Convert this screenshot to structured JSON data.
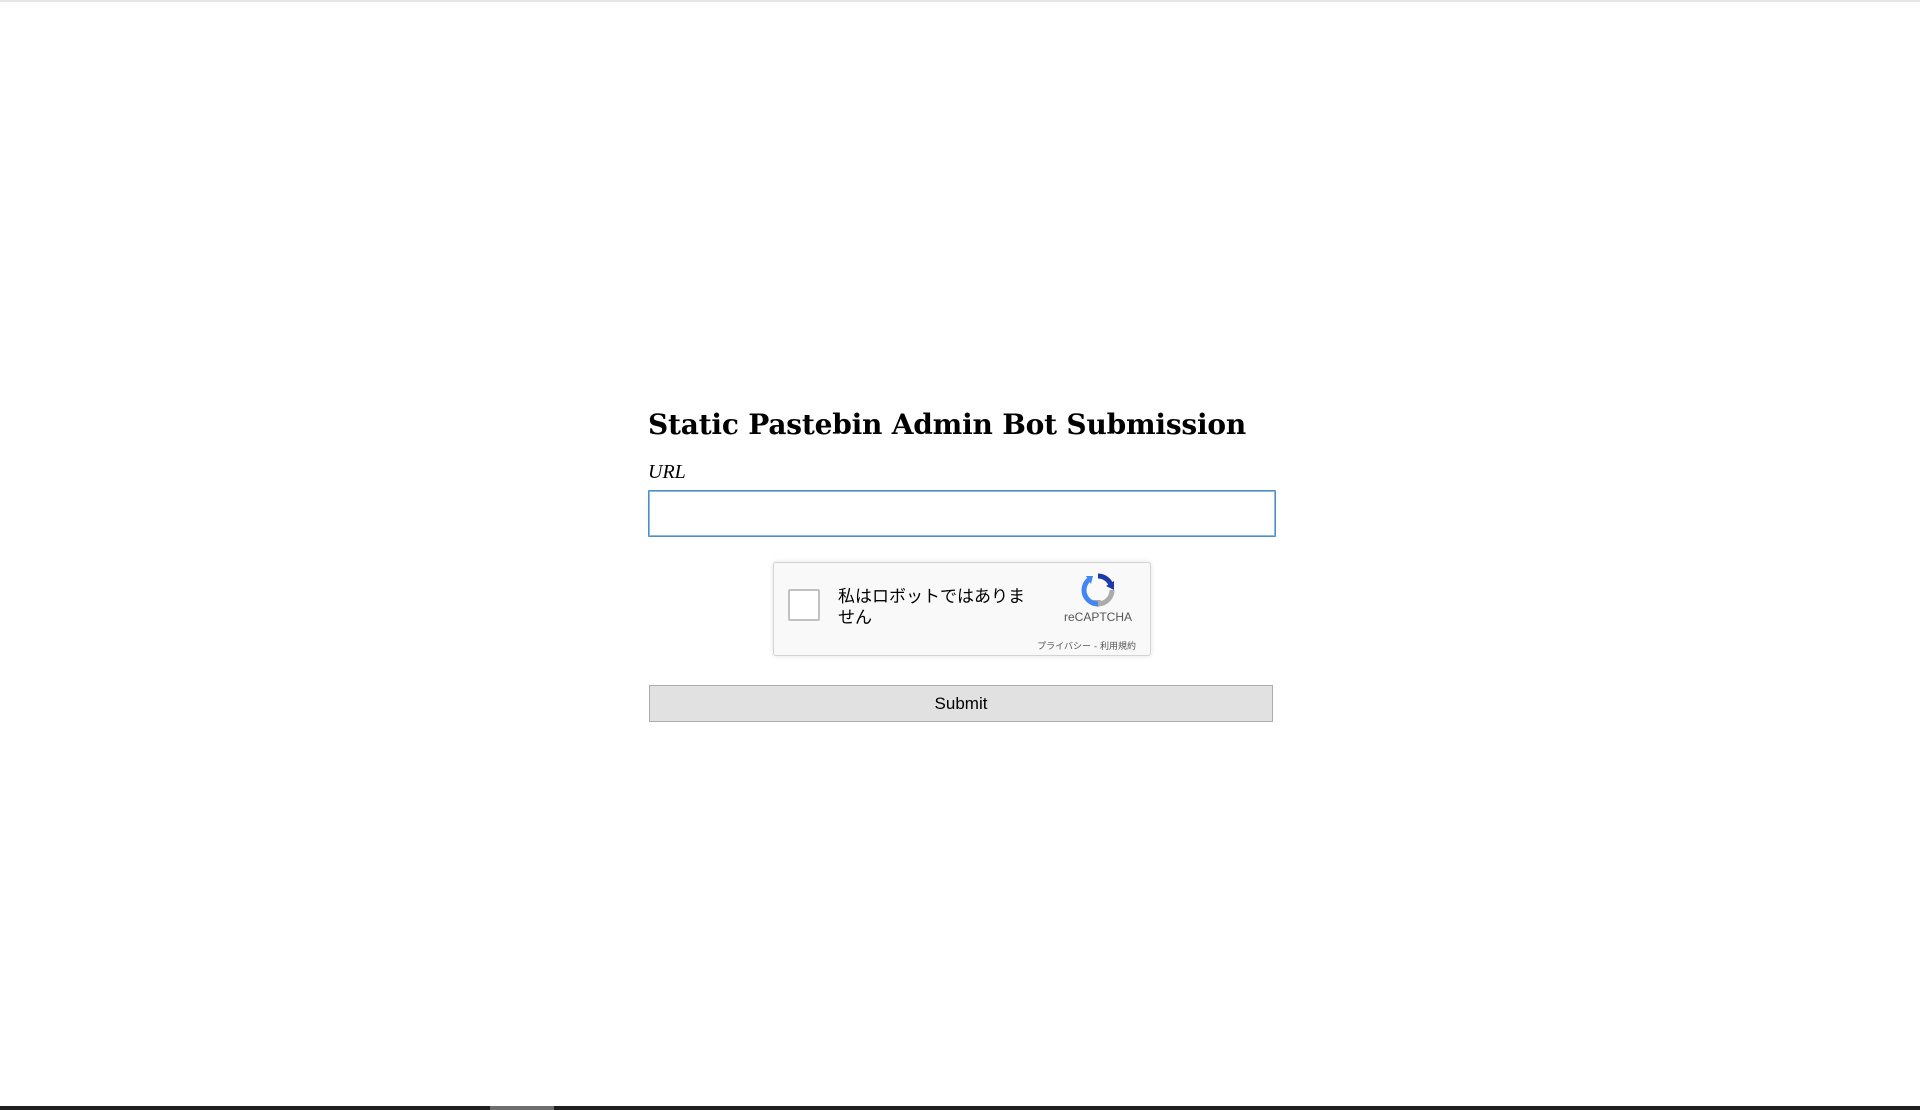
{
  "page": {
    "title": "Static Pastebin Admin Bot Submission"
  },
  "form": {
    "url_label": "URL",
    "url_value": "",
    "url_placeholder": "",
    "submit_label": "Submit"
  },
  "recaptcha": {
    "checkbox_label": "私はロボットではありません",
    "brand": "reCAPTCHA",
    "privacy_link": "プライバシー",
    "separator": " - ",
    "terms_link": "利用規約",
    "logo_icon": "recaptcha-logo-icon",
    "checked": false
  },
  "colors": {
    "input_focus_border": "#4a90c8",
    "recaptcha_blue": "#1c3aa9",
    "recaptcha_light_blue": "#4285f4",
    "recaptcha_grey": "#ababab",
    "button_bg": "#e1e1e1"
  }
}
